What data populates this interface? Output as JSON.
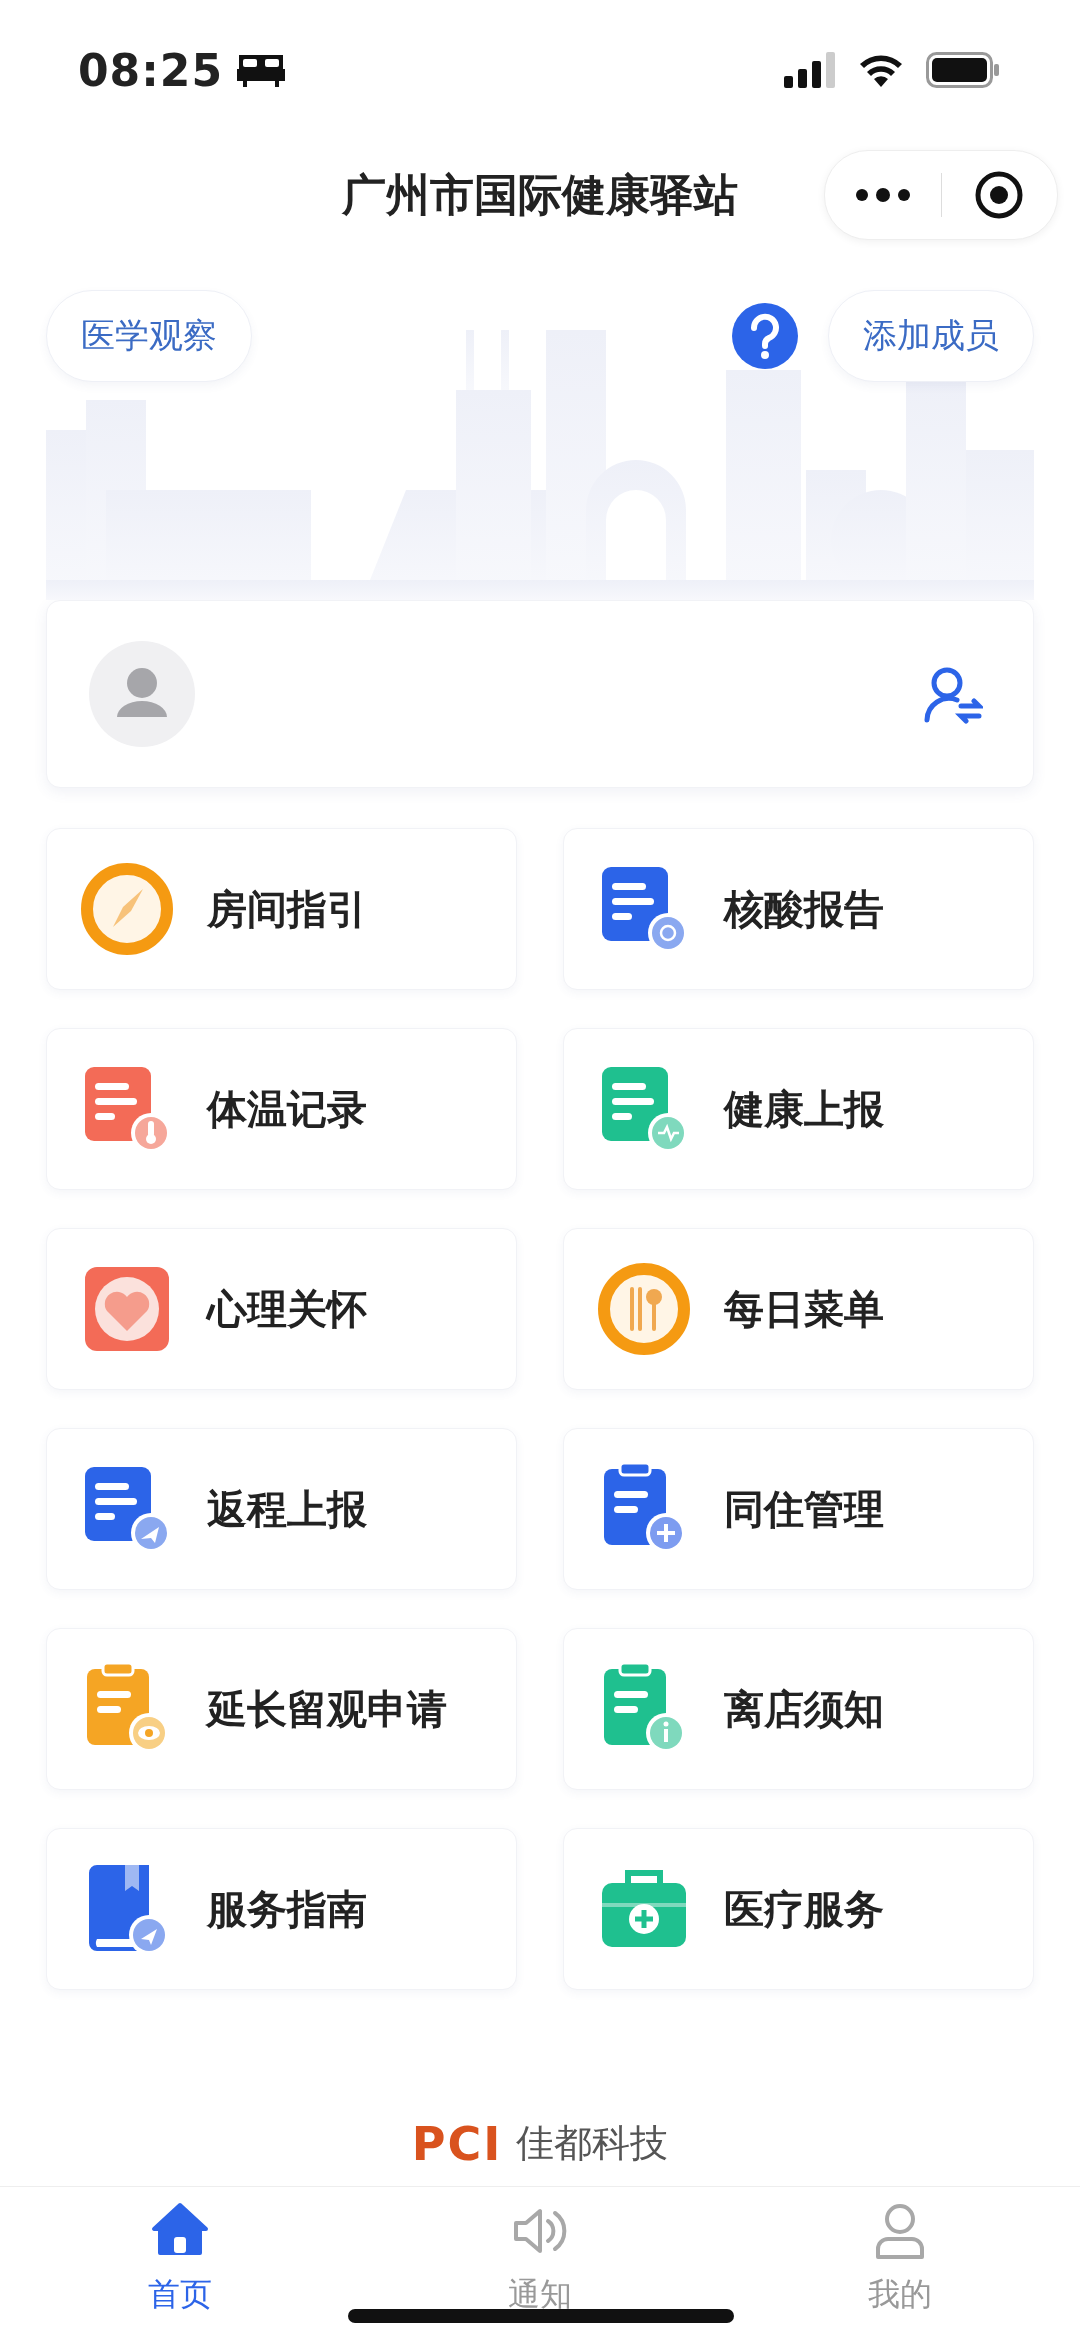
{
  "status_bar": {
    "time": "08:25"
  },
  "nav": {
    "title": "广州市国际健康驿站"
  },
  "header": {
    "left_button": "医学观察",
    "right_button": "添加成员"
  },
  "services": [
    {
      "label": "房间指引"
    },
    {
      "label": "核酸报告"
    },
    {
      "label": "体温记录"
    },
    {
      "label": "健康上报"
    },
    {
      "label": "心理关怀"
    },
    {
      "label": "每日菜单"
    },
    {
      "label": "返程上报"
    },
    {
      "label": "同住管理"
    },
    {
      "label": "延长留观申请"
    },
    {
      "label": "离店须知"
    },
    {
      "label": "服务指南"
    },
    {
      "label": "医疗服务"
    }
  ],
  "footer": {
    "logo": "PCI",
    "company": "佳都科技"
  },
  "tab_bar": [
    {
      "label": "首页",
      "selected": true
    },
    {
      "label": "通知",
      "selected": false
    },
    {
      "label": "我的",
      "selected": false
    }
  ]
}
